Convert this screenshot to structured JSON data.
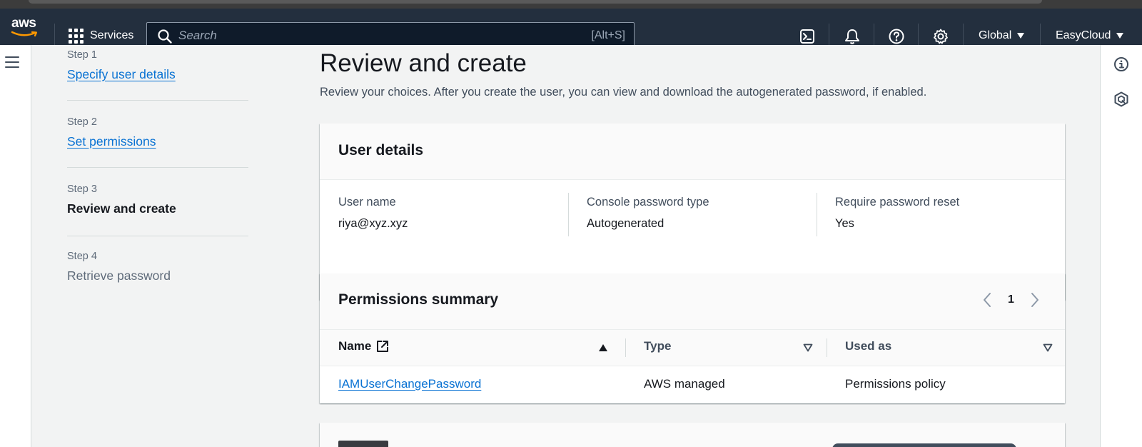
{
  "topnav": {
    "logo_text": "aws",
    "services_label": "Services",
    "search_placeholder": "Search",
    "search_shortcut": "[Alt+S]",
    "region_label": "Global",
    "account_label": "EasyCloud"
  },
  "steps": [
    {
      "label": "Step 1",
      "title": "Specify user details"
    },
    {
      "label": "Step 2",
      "title": "Set permissions"
    },
    {
      "label": "Step 3",
      "title": "Review and create"
    },
    {
      "label": "Step 4",
      "title": "Retrieve password"
    }
  ],
  "page": {
    "title": "Review and create",
    "description": "Review your choices. After you create the user, you can view and download the autogenerated password, if enabled."
  },
  "user_details": {
    "title": "User details",
    "fields": [
      {
        "label": "User name",
        "value": "riya@xyz.xyz"
      },
      {
        "label": "Console password type",
        "value": "Autogenerated"
      },
      {
        "label": "Require password reset",
        "value": "Yes"
      }
    ]
  },
  "permissions": {
    "title": "Permissions summary",
    "page_number": "1",
    "columns": [
      "Name",
      "Type",
      "Used as"
    ],
    "rows": [
      {
        "name": "IAMUserChangePassword",
        "type": "AWS managed",
        "used_as": "Permissions policy"
      }
    ]
  },
  "colors": {
    "nav_bg": "#232f3e",
    "link": "#0972d3",
    "page_bg": "#f2f3f3"
  }
}
